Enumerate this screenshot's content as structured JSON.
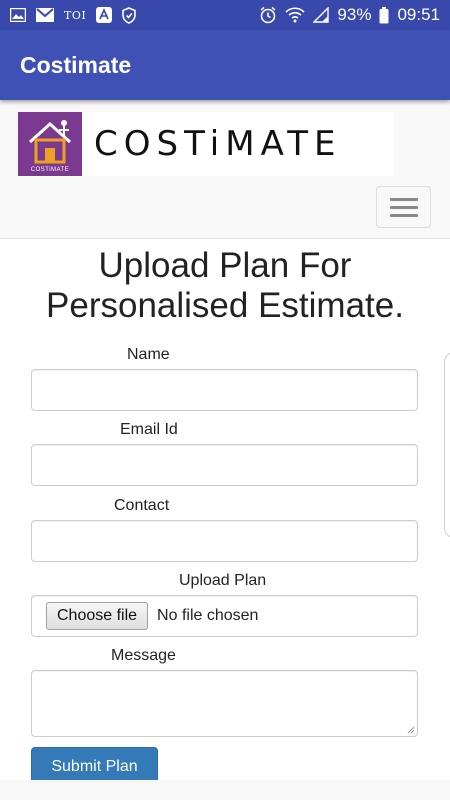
{
  "status_bar": {
    "left_icons": [
      "gallery-icon",
      "gmail-icon",
      "toi-icon",
      "acrobat-icon",
      "shield-icon"
    ],
    "toi_label": "TOI",
    "battery": "93%",
    "time": "09:51"
  },
  "app_bar": {
    "title": "Costimate"
  },
  "logo": {
    "brand_text": "COSTiMATE",
    "mini_text": "COSTiMATE"
  },
  "heading": {
    "line1": "Upload Plan For",
    "line2": "Personalised Estimate."
  },
  "form": {
    "name_label": "Name",
    "name_value": "",
    "email_label": "Email Id",
    "email_value": "",
    "contact_label": "Contact",
    "contact_value": "",
    "upload_label": "Upload Plan",
    "choose_file_label": "Choose file",
    "no_file_text": "No file chosen",
    "message_label": "Message",
    "message_value": "",
    "submit_label": "Submit Plan"
  },
  "colors": {
    "status_bar": "#3949ab",
    "app_bar": "#3f51b5",
    "submit": "#337ab7",
    "logo_purple": "#7b3a8f"
  }
}
